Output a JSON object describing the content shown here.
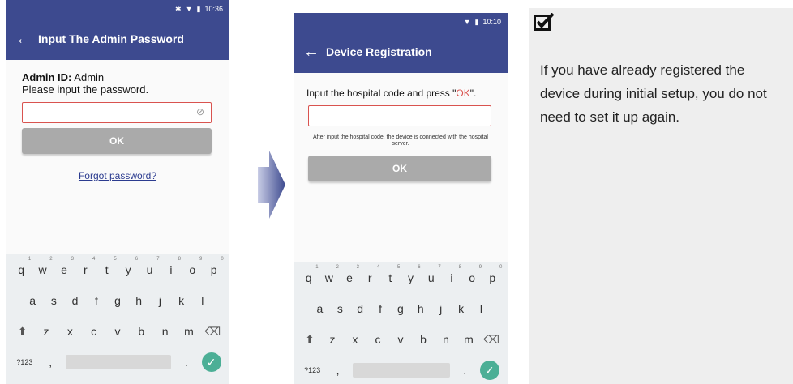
{
  "screen1": {
    "status_time": "10:36",
    "title": "Input The Admin Password",
    "admin_id_label": "Admin ID:",
    "admin_id_value": "Admin",
    "prompt": "Please input the password.",
    "ok_label": "OK",
    "forgot_label": "Forgot password?"
  },
  "screen2": {
    "status_time": "10:10",
    "title": "Device Registration",
    "instruction_prefix": "Input the hospital code and press \"",
    "instruction_ok": "OK",
    "instruction_suffix": "\".",
    "note": "After input the hospital code, the device is connected with the hospital server.",
    "ok_label": "OK"
  },
  "keyboard": {
    "row1": [
      "q",
      "w",
      "e",
      "r",
      "t",
      "y",
      "u",
      "i",
      "o",
      "p"
    ],
    "row1_hints": [
      "1",
      "2",
      "3",
      "4",
      "5",
      "6",
      "7",
      "8",
      "9",
      "0"
    ],
    "row2": [
      "a",
      "s",
      "d",
      "f",
      "g",
      "h",
      "j",
      "k",
      "l"
    ],
    "row3": [
      "z",
      "x",
      "c",
      "v",
      "b",
      "n",
      "m"
    ],
    "symbols_label": "?123",
    "comma": ",",
    "period": "."
  },
  "tip": {
    "text": "If you have already registered the device during initial setup, you do not need to set it up again."
  },
  "colors": {
    "appbar": "#3d4a8f",
    "input_border": "#d9534f",
    "ok_button": "#aaaaaa",
    "done_key": "#4caf96"
  }
}
